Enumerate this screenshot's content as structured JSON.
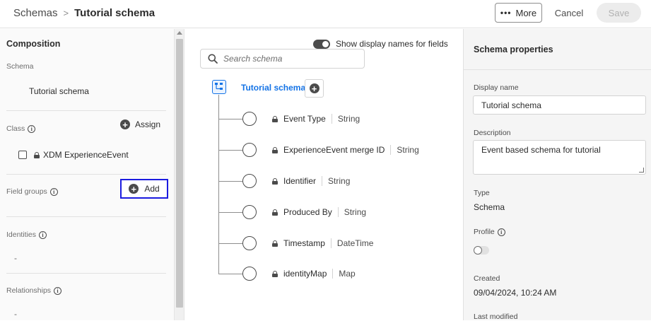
{
  "header": {
    "breadcrumb_root": "Schemas",
    "breadcrumb_sep": ">",
    "breadcrumb_current": "Tutorial schema",
    "more_label": "More",
    "cancel_label": "Cancel",
    "save_label": "Save"
  },
  "composition": {
    "title": "Composition",
    "schema_label": "Schema",
    "schema_value": "Tutorial schema",
    "class_label": "Class",
    "assign_label": "Assign",
    "class_value": "XDM ExperienceEvent",
    "field_groups_label": "Field groups",
    "add_label": "Add",
    "identities_label": "Identities",
    "identities_value": "-",
    "relationships_label": "Relationships",
    "relationships_value": "-"
  },
  "canvas": {
    "toggle_label": "Show display names for fields",
    "search_placeholder": "Search schema",
    "root_name": "Tutorial schema",
    "fields": [
      {
        "name": "Event Type",
        "type": "String"
      },
      {
        "name": "ExperienceEvent merge ID",
        "type": "String"
      },
      {
        "name": "Identifier",
        "type": "String"
      },
      {
        "name": "Produced By",
        "type": "String"
      },
      {
        "name": "Timestamp",
        "type": "DateTime"
      },
      {
        "name": "identityMap",
        "type": "Map"
      }
    ]
  },
  "properties": {
    "title": "Schema properties",
    "display_name_label": "Display name",
    "display_name_value": "Tutorial schema",
    "description_label": "Description",
    "description_value": "Event based schema for tutorial",
    "type_label": "Type",
    "type_value": "Schema",
    "profile_label": "Profile",
    "profile_enabled": false,
    "created_label": "Created",
    "created_value": "09/04/2024, 10:24 AM",
    "last_modified_label": "Last modified"
  },
  "colors": {
    "accent_blue": "#1473e6",
    "highlight_border": "#1b1be0",
    "icon_dark": "#4b4b4b"
  },
  "icons": [
    "search-icon",
    "info-icon",
    "plus-icon",
    "lock-icon",
    "schema-root-icon",
    "ellipsis-icon"
  ]
}
